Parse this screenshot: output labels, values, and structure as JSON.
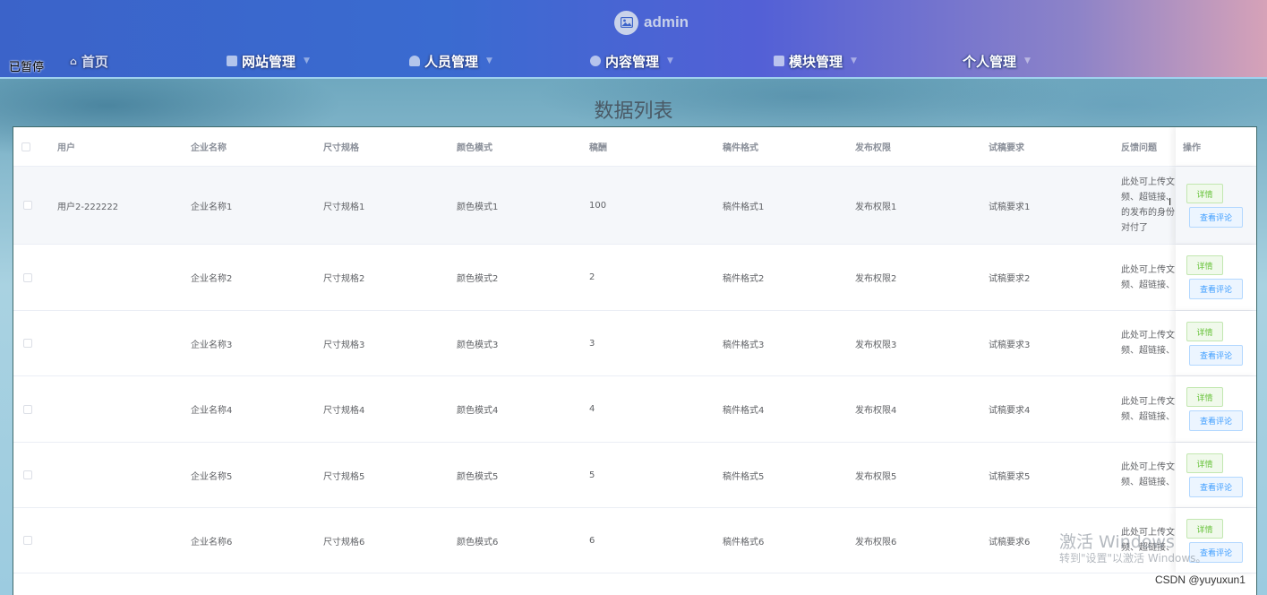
{
  "header": {
    "admin_name": "admin",
    "paused_label": "已暂停",
    "nav": [
      {
        "label": "首页",
        "icon": "home-icon"
      },
      {
        "label": "网站管理",
        "icon": "monitor-icon"
      },
      {
        "label": "人员管理",
        "icon": "user-icon"
      },
      {
        "label": "内容管理",
        "icon": "globe-icon"
      },
      {
        "label": "模块管理",
        "icon": "module-icon"
      },
      {
        "label": "个人管理",
        "icon": "person-icon"
      }
    ]
  },
  "page_title": "数据列表",
  "table": {
    "columns": [
      "用户",
      "企业名称",
      "尺寸规格",
      "颜色模式",
      "稿酬",
      "稿件格式",
      "发布权限",
      "试稿要求",
      "反馈问题",
      "操作"
    ],
    "rows": [
      {
        "user": "用户2-222222",
        "company": "企业名称1",
        "size": "尺寸规格1",
        "color": "颜色模式1",
        "fee": "100",
        "format": "稿件格式1",
        "permission": "发布权限1",
        "trial": "试稿要求1",
        "feedback": [
          "此处可上传文",
          "频、超链接、",
          "的发布的身份",
          "对付了"
        ]
      },
      {
        "user": "",
        "company": "企业名称2",
        "size": "尺寸规格2",
        "color": "颜色模式2",
        "fee": "2",
        "format": "稿件格式2",
        "permission": "发布权限2",
        "trial": "试稿要求2",
        "feedback": [
          "此处可上传文",
          "频、超链接、"
        ]
      },
      {
        "user": "",
        "company": "企业名称3",
        "size": "尺寸规格3",
        "color": "颜色模式3",
        "fee": "3",
        "format": "稿件格式3",
        "permission": "发布权限3",
        "trial": "试稿要求3",
        "feedback": [
          "此处可上传文",
          "频、超链接、"
        ]
      },
      {
        "user": "",
        "company": "企业名称4",
        "size": "尺寸规格4",
        "color": "颜色模式4",
        "fee": "4",
        "format": "稿件格式4",
        "permission": "发布权限4",
        "trial": "试稿要求4",
        "feedback": [
          "此处可上传文",
          "频、超链接、"
        ]
      },
      {
        "user": "",
        "company": "企业名称5",
        "size": "尺寸规格5",
        "color": "颜色模式5",
        "fee": "5",
        "format": "稿件格式5",
        "permission": "发布权限5",
        "trial": "试稿要求5",
        "feedback": [
          "此处可上传文",
          "频、超链接、"
        ]
      },
      {
        "user": "",
        "company": "企业名称6",
        "size": "尺寸规格6",
        "color": "颜色模式6",
        "fee": "6",
        "format": "稿件格式6",
        "permission": "发布权限6",
        "trial": "试稿要求6",
        "feedback": [
          "此处可上传文",
          "频、超链接、"
        ]
      }
    ],
    "detail_label": "详情",
    "comment_label": "查看评论"
  },
  "watermark": {
    "line1": "激活 Windows",
    "line2": "转到\"设置\"以激活 Windows。"
  },
  "csdn_label": "CSDN @yuyuxun1",
  "colors": {
    "header_start": "#3b63c9",
    "header_end": "#d6a2b8",
    "detail_green": "#67c23a",
    "comment_blue": "#409eff"
  }
}
